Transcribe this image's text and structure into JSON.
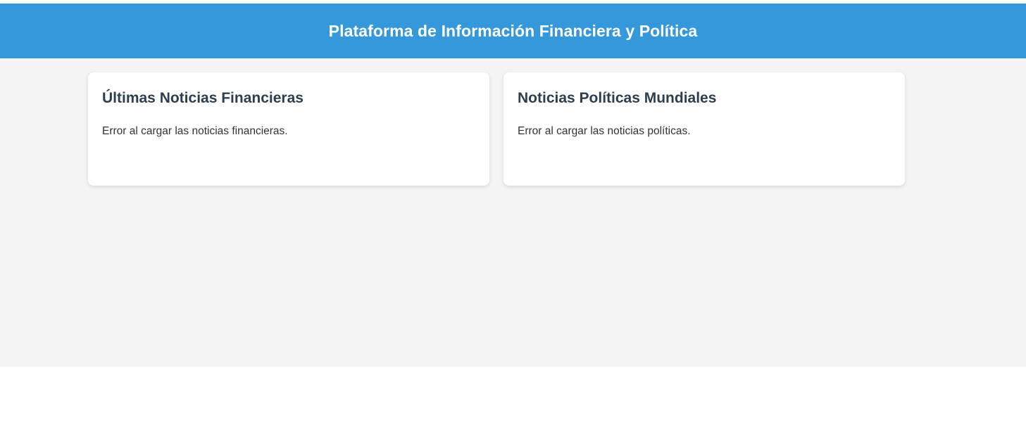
{
  "header": {
    "title": "Plataforma de Información Financiera y Política"
  },
  "sections": [
    {
      "title": "Últimas Noticias Financieras",
      "message": "Error al cargar las noticias financieras."
    },
    {
      "title": "Noticias Políticas Mundiales",
      "message": "Error al cargar las noticias políticas."
    }
  ],
  "colors": {
    "header_bg": "#3498db",
    "main_bg": "#f4f4f4",
    "card_bg": "#ffffff",
    "heading_text": "#2c3e50"
  }
}
